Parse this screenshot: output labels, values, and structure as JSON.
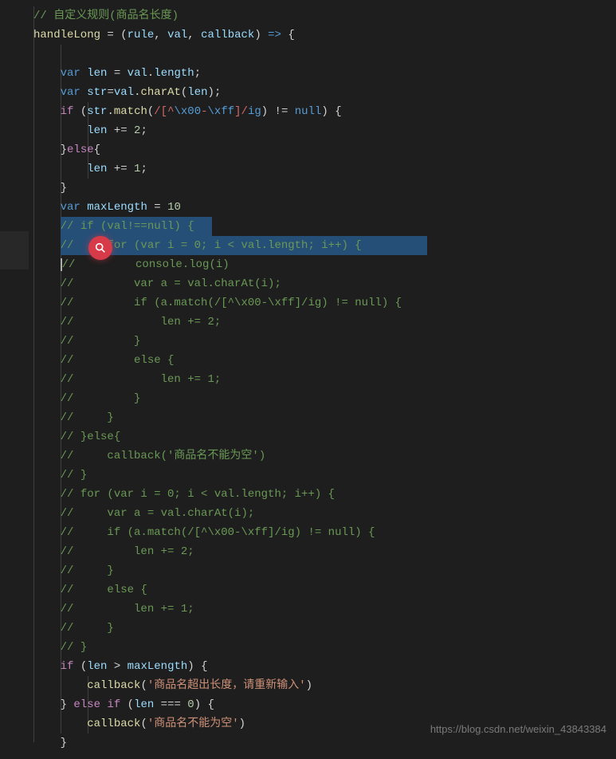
{
  "watermark": "https://blog.csdn.net/weixin_43843384",
  "code": {
    "l1_comment": "// 自定义规则(商品名长度)",
    "l2_fn": "handleLong",
    "l2_rule": "rule",
    "l2_val": "val",
    "l2_cb": "callback",
    "l4_var": "var",
    "l4_len": "len",
    "l4_val": "val",
    "l4_length": "length",
    "l5_var": "var",
    "l5_str": "str",
    "l5_val": "val",
    "l5_charAt": "charAt",
    "l5_len": "len",
    "l6_if": "if",
    "l6_str": "str",
    "l6_match": "match",
    "l6_regex_open": "/[^",
    "l6_regex_esc1": "\\x00",
    "l6_regex_mid": "-",
    "l6_regex_esc2": "\\xff",
    "l6_regex_close": "]/",
    "l6_flags": "ig",
    "l6_null": "null",
    "l7_len": "len",
    "l7_num": "2",
    "l8_else": "else",
    "l9_len": "len",
    "l9_num": "1",
    "l11_var": "var",
    "l11_maxLength": "maxLength",
    "l11_num": "10",
    "l12": "// if (val!==null) {",
    "l13": "//     for (var i = 0; i < val.length; i++) {",
    "l14": "//         console.log(i)",
    "l15": "//         var a = val.charAt(i);",
    "l16": "//         if (a.match(/[^\\x00-\\xff]/ig) != null) {",
    "l17": "//             len += 2;",
    "l18": "//         }",
    "l19": "//         else {",
    "l20": "//             len += 1;",
    "l21": "//         }",
    "l22": "//     }",
    "l23": "// }else{",
    "l24": "//     callback('商品名不能为空')",
    "l25": "// }",
    "l26": "// for (var i = 0; i < val.length; i++) {",
    "l27": "//     var a = val.charAt(i);",
    "l28": "//     if (a.match(/[^\\x00-\\xff]/ig) != null) {",
    "l29": "//         len += 2;",
    "l30": "//     }",
    "l31": "//     else {",
    "l32": "//         len += 1;",
    "l33": "//     }",
    "l34": "// }",
    "l35_if": "if",
    "l35_len": "len",
    "l35_maxLength": "maxLength",
    "l36_cb": "callback",
    "l36_str": "'商品名超出长度，请重新输入'",
    "l37_else": "else",
    "l37_if": "if",
    "l37_len": "len",
    "l37_num": "0",
    "l38_cb": "callback",
    "l38_str": "'商品名不能为空'"
  }
}
